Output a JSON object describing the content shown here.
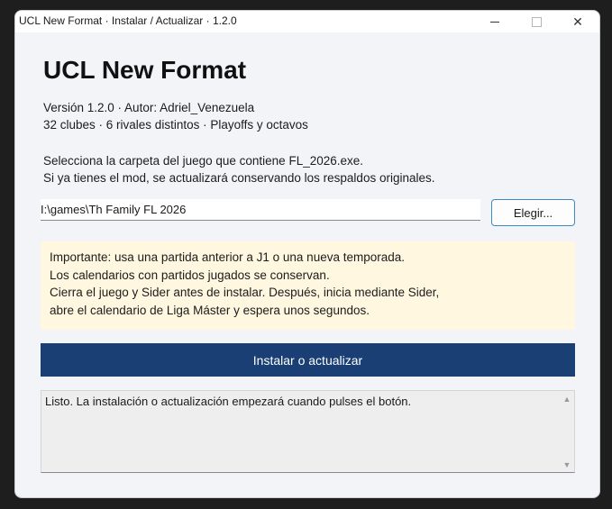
{
  "window": {
    "title": "UCL New Format · Instalar / Actualizar · 1.2.0",
    "controls": {
      "minimize": "minimize",
      "maximize": "maximize",
      "close": "✕"
    }
  },
  "header": {
    "title": "UCL New Format",
    "version_line": "Versión 1.2.0  ·  Autor: Adriel_Venezuela",
    "info_line": "32 clubes · 6 rivales distintos · Playoffs y octavos"
  },
  "instructions": {
    "line1": "Selecciona la carpeta del juego que contiene FL_2026.exe.",
    "line2": "Si ya tienes el mod, se actualizará conservando los respaldos originales."
  },
  "folder": {
    "path_value": "I:\\games\\Th Family FL 2026",
    "browse_label": "Elegir..."
  },
  "notice": {
    "line1": "Importante: usa una partida anterior a J1 o una nueva temporada.",
    "line2": "Los calendarios con partidos jugados se conservan.",
    "line3": "Cierra el juego y Sider antes de instalar. Después, inicia mediante Sider,",
    "line4": "abre el calendario de Liga Máster y espera unos segundos."
  },
  "actions": {
    "install_label": "Instalar o actualizar"
  },
  "log": {
    "text": "Listo. La instalación o actualización empezará cuando pulses el botón.",
    "scroll_up": "▲",
    "scroll_down": "▼"
  },
  "colors": {
    "accent": "#1a3f74",
    "notice_bg": "#fff7df",
    "window_bg": "#f3f4f8",
    "browse_border": "#3b8bc2"
  }
}
